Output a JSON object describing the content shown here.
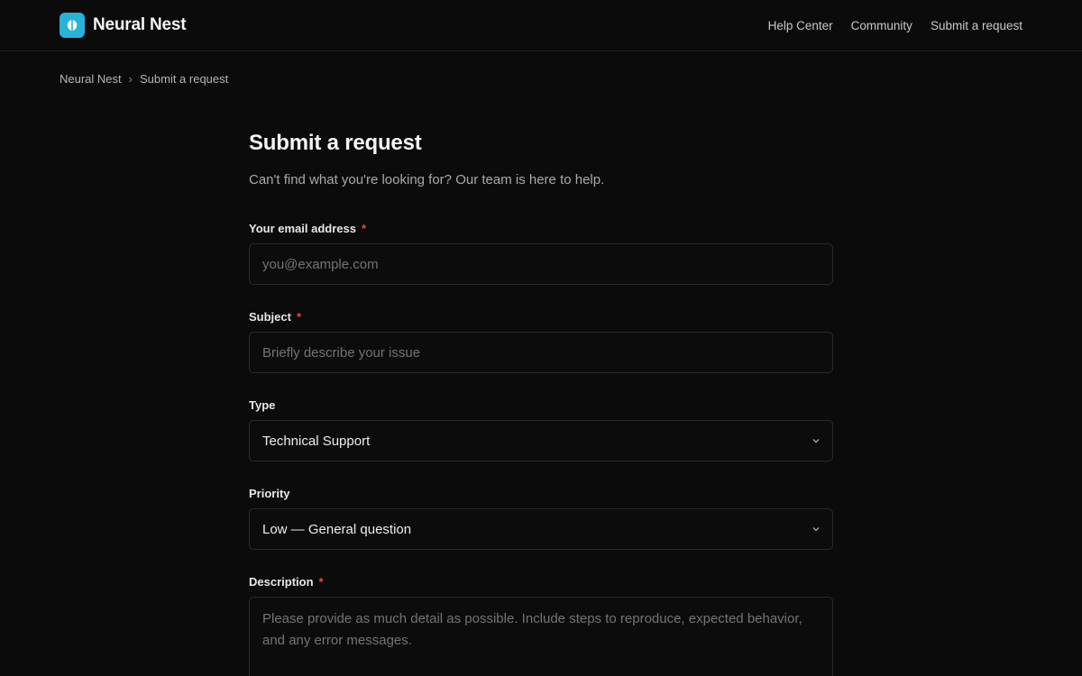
{
  "header": {
    "brand_name": "Neural Nest",
    "nav": [
      "Help Center",
      "Community",
      "Submit a request"
    ],
    "brand_color": "#27b3d8"
  },
  "breadcrumb": {
    "items": [
      "Neural Nest",
      "Submit a request"
    ],
    "separator": "›"
  },
  "page": {
    "title": "Submit a request",
    "intro": "Can't find what you're looking for? Our team is here to help."
  },
  "form": {
    "email": {
      "label": "Your email address",
      "required": "*",
      "placeholder": "you@example.com"
    },
    "subject": {
      "label": "Subject",
      "required": "*",
      "placeholder": "Briefly describe your issue"
    },
    "type": {
      "label": "Type",
      "value": "Technical Support"
    },
    "priority": {
      "label": "Priority",
      "value": "Low — General question"
    },
    "description": {
      "label": "Description",
      "required": "*",
      "placeholder": "Please provide as much detail as possible. Include steps to reproduce, expected behavior, and any error messages."
    }
  },
  "icons": {
    "logo": "brain-icon",
    "select": "chevron-down-icon"
  }
}
